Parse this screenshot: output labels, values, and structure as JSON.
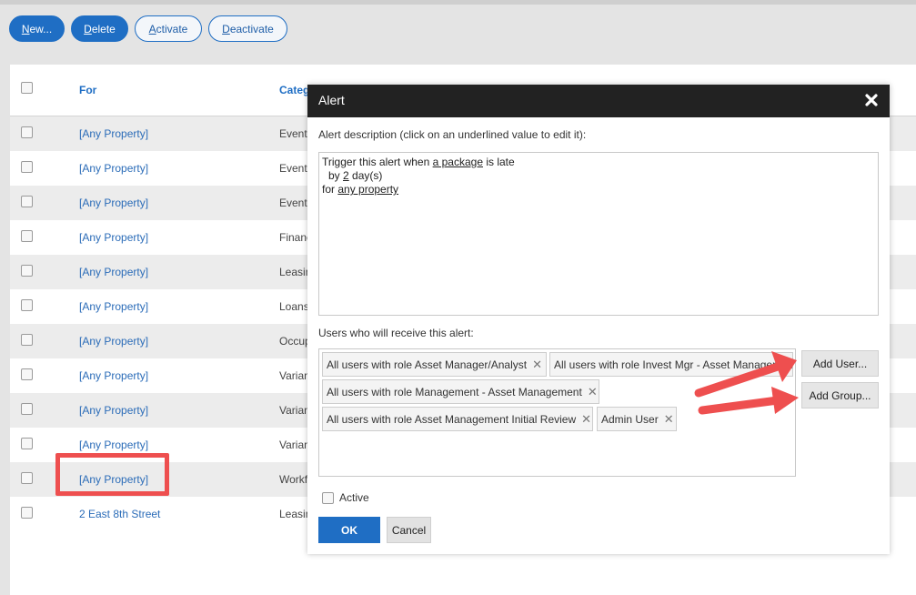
{
  "toolbar": {
    "new_label": "New...",
    "delete_label": "Delete",
    "activate_label": "Activate",
    "deactivate_label": "Deactivate"
  },
  "table": {
    "columns": {
      "for": "For",
      "category": "Categ"
    },
    "rows": [
      {
        "for": "[Any Property]",
        "category": "Events"
      },
      {
        "for": "[Any Property]",
        "category": "Events"
      },
      {
        "for": "[Any Property]",
        "category": "Events"
      },
      {
        "for": "[Any Property]",
        "category": "Finance"
      },
      {
        "for": "[Any Property]",
        "category": "Leasing"
      },
      {
        "for": "[Any Property]",
        "category": "Loans"
      },
      {
        "for": "[Any Property]",
        "category": "Occupancy"
      },
      {
        "for": "[Any Property]",
        "category": "Variance"
      },
      {
        "for": "[Any Property]",
        "category": "Variance"
      },
      {
        "for": "[Any Property]",
        "category": "Variance"
      },
      {
        "for": "[Any Property]",
        "category": "Workflow"
      },
      {
        "for": "2 East 8th Street",
        "category": "Leasing"
      }
    ]
  },
  "modal": {
    "title": "Alert",
    "description_label": "Alert description (click on an underlined value to edit it):",
    "description": {
      "line1_prefix": "Trigger this alert when ",
      "line1_value": "a package",
      "line1_suffix": " is late",
      "line2_prefix": "by ",
      "line2_value": "2",
      "line2_suffix": " day(s)",
      "line3_prefix": "for ",
      "line3_value": "any property"
    },
    "users_label": "Users who will receive this alert:",
    "recipients": [
      "All users with role Asset Manager/Analyst",
      "All users with role Invest Mgr - Asset Management",
      "All users with role Management - Asset Management",
      "All users with role Asset Management Initial Review",
      "Admin User"
    ],
    "add_user_label": "Add User...",
    "add_group_label": "Add Group...",
    "active_label": "Active",
    "ok_label": "OK",
    "cancel_label": "Cancel"
  },
  "colors": {
    "primary": "#1f6ec4",
    "modal_header": "#222222",
    "annotation_red": "#ee4f4f"
  }
}
